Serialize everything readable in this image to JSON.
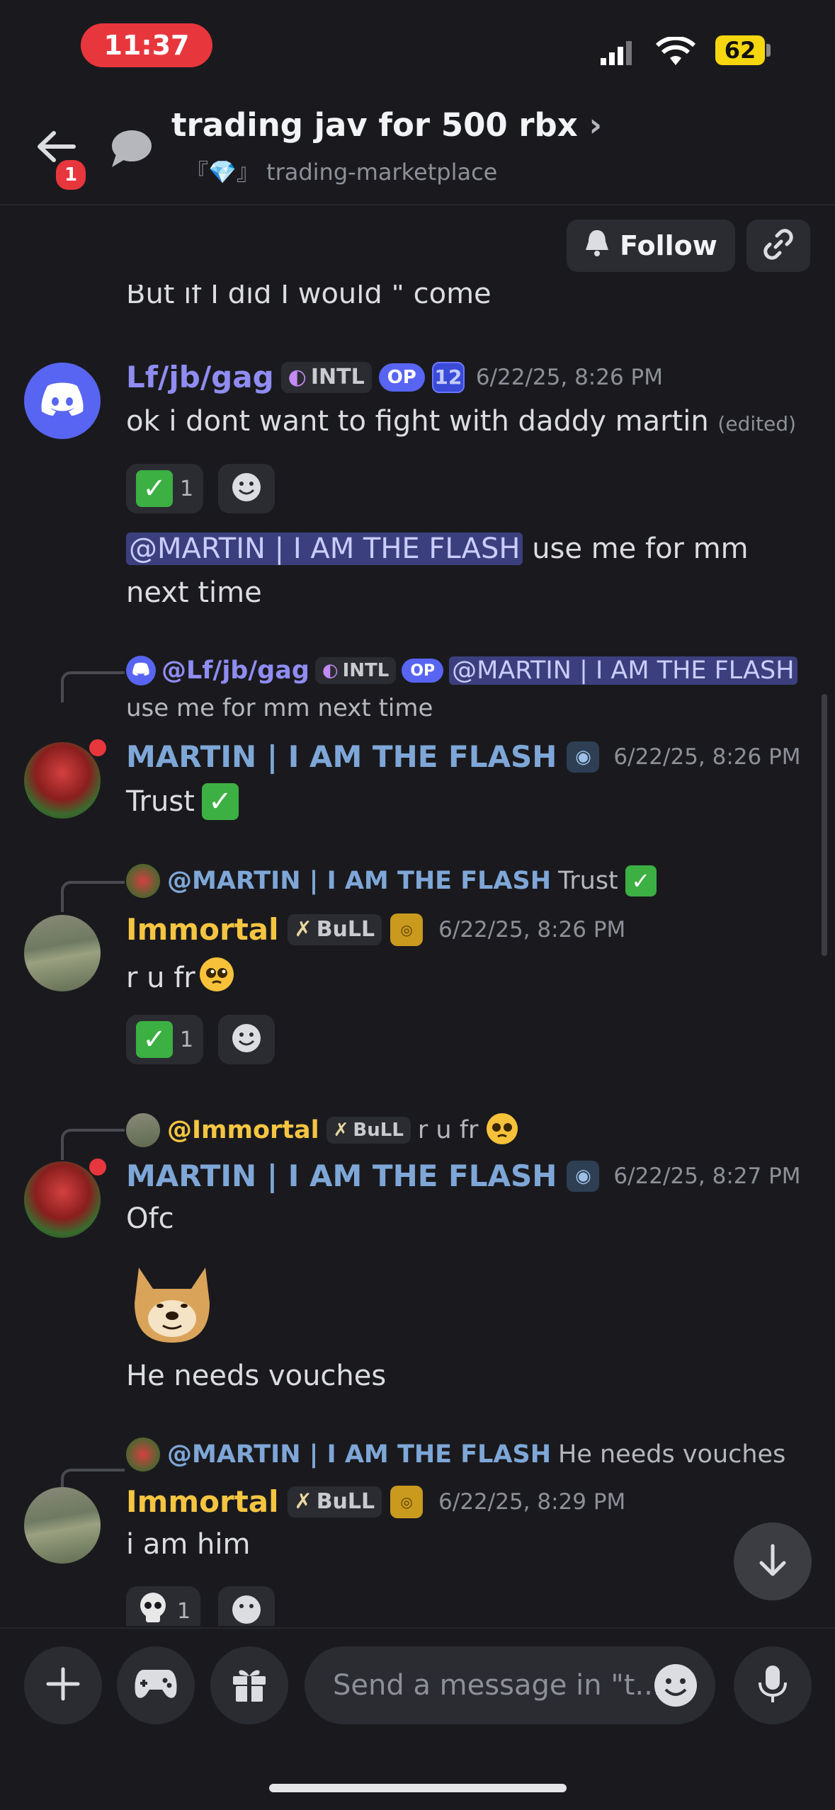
{
  "status_bar": {
    "time": "11:37",
    "battery": "62"
  },
  "header": {
    "back_badge": "1",
    "title": "trading jav for 500 rbx",
    "channel_prefix": "『💎』",
    "channel": "trading-marketplace",
    "follow_label": "Follow"
  },
  "partial_top_text": "But if I did I would \" come",
  "messages": [
    {
      "username": "Lf/jb/gag",
      "tag": "INTL",
      "op": "OP",
      "level": "12",
      "timestamp": "6/22/25, 8:26 PM",
      "text": "ok i dont want to fight with daddy martin",
      "edited": "(edited)",
      "reaction_count": "1",
      "followup_mention": "@MARTIN | I AM THE FLASH",
      "followup_text_1": "use me for mm",
      "followup_text_2": "next time"
    },
    {
      "reply_user": "@Lf/jb/gag",
      "reply_tag": "INTL",
      "reply_op": "OP",
      "reply_mention": "@MARTIN | I AM THE FLASH",
      "reply_text": "use me for mm next time",
      "username": "MARTIN | I AM THE FLASH",
      "timestamp": "6/22/25, 8:26 PM",
      "text": "Trust"
    },
    {
      "reply_user": "@MARTIN | I AM THE FLASH",
      "reply_text": "Trust",
      "username": "Immortal",
      "tag": "BuLL",
      "timestamp": "6/22/25, 8:26 PM",
      "text": "r u fr",
      "reaction_count": "1"
    },
    {
      "reply_user": "@Immortal",
      "reply_tag": "BuLL",
      "reply_text": "r u fr",
      "username": "MARTIN | I AM THE FLASH",
      "timestamp": "6/22/25, 8:27 PM",
      "text": "Ofc",
      "text_2": "He needs vouches"
    },
    {
      "reply_user": "@MARTIN | I AM THE FLASH",
      "reply_text": "He needs vouches",
      "username": "Immortal",
      "tag": "BuLL",
      "timestamp": "6/22/25, 8:29 PM",
      "text": "i am him",
      "reaction_count": "1"
    }
  ],
  "composer": {
    "placeholder": "Send a message in \"t..."
  },
  "colors": {
    "accent_blue": "#7ea7d8",
    "gold": "#f5c542",
    "purple_name": "#8f8cf2"
  }
}
